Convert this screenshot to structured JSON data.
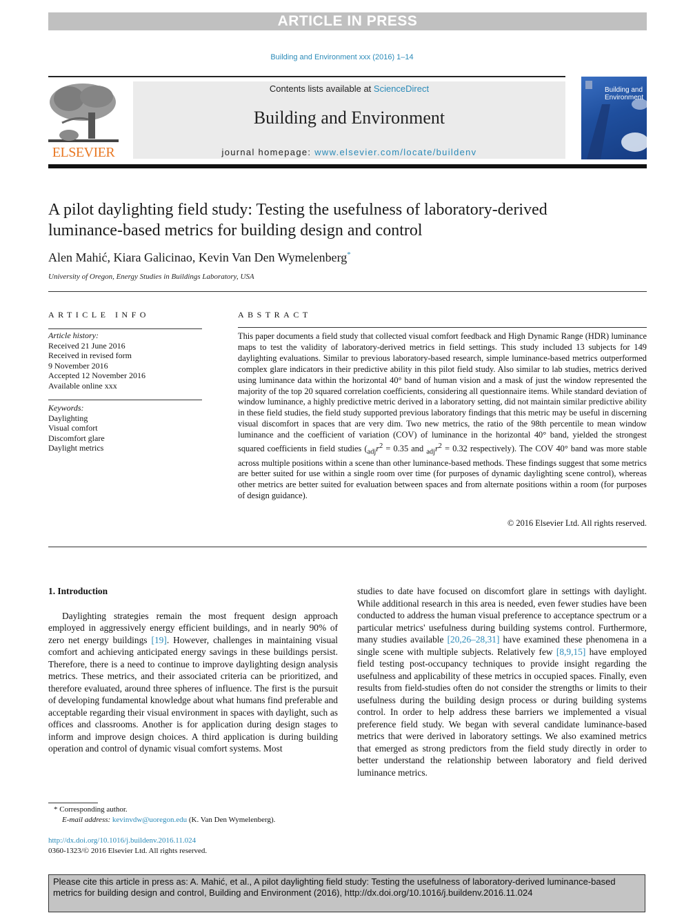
{
  "banner": "ARTICLE IN PRESS",
  "journal_ref": "Building and Environment xxx (2016) 1–14",
  "header": {
    "publisher_logo": "ELSEVIER",
    "contents_prefix": "Contents lists available at ",
    "contents_link": "ScienceDirect",
    "journal_title": "Building and Environment",
    "homepage_prefix": "journal homepage: ",
    "homepage_link": "www.elsevier.com/locate/buildenv",
    "cover_title_1": "Building and",
    "cover_title_2": "Environment",
    "cover_icon": "journal-cover-image"
  },
  "article": {
    "title": "A pilot daylighting field study: Testing the usefulness of laboratory-derived luminance-based metrics for building design and control",
    "authors": "Alen Mahić, Kiara Galicinao, Kevin Van Den Wymelenberg",
    "author_mark": "*",
    "affiliation": "University of Oregon, Energy Studies in Buildings Laboratory, USA"
  },
  "article_info": {
    "heading": "ARTICLE INFO",
    "history_label": "Article history:",
    "history": [
      "Received 21 June 2016",
      "Received in revised form",
      "9 November 2016",
      "Accepted 12 November 2016",
      "Available online xxx"
    ],
    "keywords_label": "Keywords:",
    "keywords": [
      "Daylighting",
      "Visual comfort",
      "Discomfort glare",
      "Daylight metrics"
    ]
  },
  "abstract": {
    "heading": "ABSTRACT",
    "text_1": "This paper documents a field study that collected visual comfort feedback and High Dynamic Range (HDR) luminance maps to test the validity of laboratory-derived metrics in field settings. This study included 13 subjects for 149 daylighting evaluations. Similar to previous laboratory-based research, simple luminance-based metrics outperformed complex glare indicators in their predictive ability in this pilot field study. Also similar to lab studies, metrics derived using luminance data within the horizontal 40° band of human vision and a mask of just the window represented the majority of the top 20 squared correlation coefficients, considering all questionnaire items. While standard deviation of window luminance, a highly predictive metric derived in a laboratory setting, did not maintain similar predictive ability in these field studies, the field study supported previous laboratory findings that this metric may be useful in discerning visual discomfort in spaces that are very dim. Two new metrics, the ratio of the 98th percentile to mean window luminance and the coefficient of variation (COV) of luminance in the horizontal 40° band, yielded the strongest squared coefficients in field studies (",
    "adj_1": "adj",
    "r2_1": "r",
    "val_1": " = 0.35 and ",
    "adj_2": "adj",
    "r2_2": "r",
    "text_2": " = 0.32 respectively). The COV 40° band was more stable across multiple positions within a scene than other luminance-based methods. These findings suggest that some metrics are better suited for use within a single room over time (for purposes of dynamic daylighting scene control), whereas other metrics are better suited for evaluation between spaces and from alternate positions within a room (for purposes of design guidance).",
    "copyright": "© 2016 Elsevier Ltd. All rights reserved."
  },
  "body": {
    "section_heading": "1.  Introduction",
    "left_p1_a": "Daylighting strategies remain the most frequent design approach employed in aggressively energy efficient buildings, and in nearly 90% of zero net energy buildings ",
    "left_cite_1": "[19]",
    "left_p1_b": ". However, challenges in maintaining visual comfort and achieving anticipated energy savings in these buildings persist. Therefore, there is a need to continue to improve daylighting design analysis metrics. These metrics, and their associated criteria can be prioritized, and therefore evaluated, around three spheres of influence. The first is the pursuit of developing fundamental knowledge about what humans find preferable and acceptable regarding their visual environment in spaces with daylight, such as offices and classrooms. Another is for application during design stages to inform and improve design choices. A third application is during building operation and control of dynamic visual comfort systems. Most",
    "right_a": "studies to date have focused on discomfort glare in settings with daylight. While additional research in this area is needed, even fewer studies have been conducted to address the human visual preference to acceptance spectrum or a particular metrics' usefulness during building systems control. Furthermore, many studies available ",
    "right_cite_1": "[20,26–28,31]",
    "right_b": " have examined these phenomena in a single scene with multiple subjects. Relatively few ",
    "right_cite_2": "[8,9,15]",
    "right_c": " have employed field testing post-occupancy techniques to provide insight regarding the usefulness and applicability of these metrics in occupied spaces. Finally, even results from field-studies often do not consider the strengths or limits to their usefulness during the building design process or during building systems control. In order to help address these barriers we implemented a visual preference field study. We began with several candidate luminance-based metrics that were derived in laboratory settings. We also examined metrics that emerged as strong predictors from the field study directly in order to better understand the relationship between laboratory and field derived luminance metrics."
  },
  "footnote": {
    "mark": "*",
    "corresponding": " Corresponding author.",
    "email_label": "E-mail address: ",
    "email": "kevinvdw@uoregon.edu",
    "email_suffix": " (K. Van Den Wymelenberg).",
    "doi": "http://dx.doi.org/10.1016/j.buildenv.2016.11.024",
    "issn": "0360-1323/© 2016 Elsevier Ltd. All rights reserved."
  },
  "citation_box": "Please cite this article in press as: A. Mahić, et al., A pilot daylighting field study: Testing the usefulness of laboratory-derived luminance-based metrics for building design and control, Building and Environment (2016), http://dx.doi.org/10.1016/j.buildenv.2016.11.024",
  "colors": {
    "link": "#2a8ab8",
    "elsevier_orange": "#e87722",
    "banner_gray": "#c0c0c0"
  }
}
